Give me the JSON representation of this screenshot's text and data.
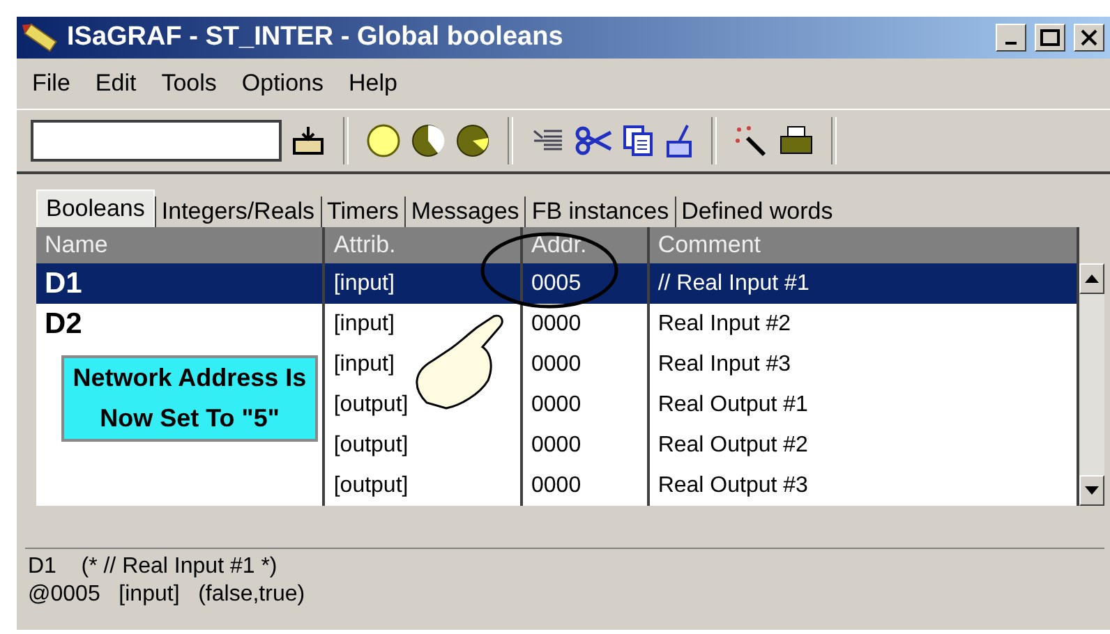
{
  "window": {
    "title": "ISaGRAF - ST_INTER - Global booleans"
  },
  "menu": [
    "File",
    "Edit",
    "Tools",
    "Options",
    "Help"
  ],
  "tabs": [
    {
      "label": "Booleans",
      "selected": true
    },
    {
      "label": "Integers/Reals",
      "selected": false
    },
    {
      "label": "Timers",
      "selected": false
    },
    {
      "label": "Messages",
      "selected": false
    },
    {
      "label": "FB instances",
      "selected": false
    },
    {
      "label": "Defined words",
      "selected": false
    }
  ],
  "table": {
    "columns": [
      "Name",
      "Attrib.",
      "Addr.",
      "Comment"
    ],
    "rows": [
      {
        "name": "D1",
        "attrib": "[input]",
        "addr": "0005",
        "comment": "// Real Input #1",
        "selected": true
      },
      {
        "name": "D2",
        "attrib": "[input]",
        "addr": "0000",
        "comment": "Real Input #2",
        "selected": false
      },
      {
        "attrib": "[input]",
        "addr": "0000",
        "comment": "Real Input #3",
        "selected": false
      },
      {
        "attrib": "[output]",
        "addr": "0000",
        "comment": "Real Output #1",
        "selected": false
      },
      {
        "attrib": "[output]",
        "addr": "0000",
        "comment": "Real Output #2",
        "selected": false
      },
      {
        "attrib": "[output]",
        "addr": "0000",
        "comment": "Real Output #3",
        "selected": false
      }
    ]
  },
  "callout": {
    "text": "Network Address Is Now Set To \"5\""
  },
  "info_panel": {
    "lines": [
      "D1    (* // Real Input #1 *)",
      "@0005   [input]   (false,true)"
    ]
  }
}
